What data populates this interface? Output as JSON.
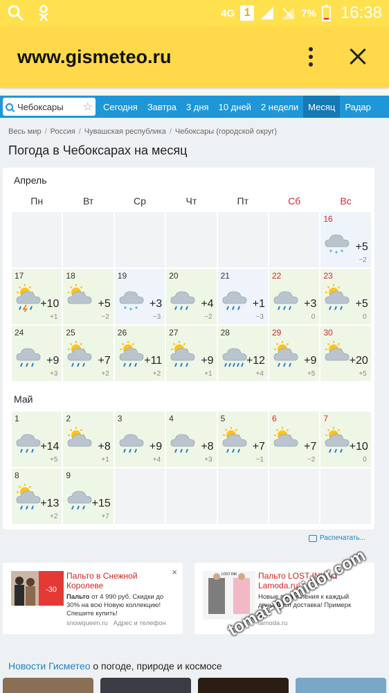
{
  "status_bar": {
    "network": "4G",
    "sim_badge": "1",
    "battery": "7%",
    "time": "16:38"
  },
  "url_bar": {
    "url": "www.gismeteo.ru"
  },
  "nav": {
    "city": "Чебоксары",
    "items": [
      {
        "label": "Сегодня"
      },
      {
        "label": "Завтра"
      },
      {
        "label": "3 дня"
      },
      {
        "label": "10 дней"
      },
      {
        "label": "2 недели"
      },
      {
        "label": "Месяц",
        "active": true
      },
      {
        "label": "Радар"
      }
    ]
  },
  "breadcrumbs": [
    "Весь мир",
    "Россия",
    "Чувашская республика",
    "Чебоксары (городской округ)"
  ],
  "page_title": "Погода в Чебоксарах на месяц",
  "weekdays": [
    "Пн",
    "Вт",
    "Ср",
    "Чт",
    "Пт",
    "Сб",
    "Вс"
  ],
  "months": [
    {
      "name": "Апрель",
      "cells": [
        null,
        null,
        null,
        null,
        null,
        null,
        {
          "day": "16",
          "hi": "+5",
          "lo": "−2",
          "icon": "cloud-snow-icon",
          "bg": "cool"
        },
        {
          "day": "17",
          "hi": "+10",
          "lo": "+1",
          "icon": "sun-cloud-storm-icon",
          "bg": "warm"
        },
        {
          "day": "18",
          "hi": "+5",
          "lo": "−2",
          "icon": "sun-cloud-icon",
          "bg": "warm"
        },
        {
          "day": "19",
          "hi": "+3",
          "lo": "−3",
          "icon": "cloud-snow-icon",
          "bg": "cool"
        },
        {
          "day": "20",
          "hi": "+4",
          "lo": "−2",
          "icon": "cloud-rain-icon",
          "bg": "warm"
        },
        {
          "day": "21",
          "hi": "+1",
          "lo": "−3",
          "icon": "cloud-rain-icon",
          "bg": "cool"
        },
        {
          "day": "22",
          "hi": "+3",
          "lo": "0",
          "icon": "cloud-rain-icon",
          "bg": "warm"
        },
        {
          "day": "23",
          "hi": "+5",
          "lo": "0",
          "icon": "sun-cloud-rain-icon",
          "bg": "warm"
        },
        {
          "day": "24",
          "hi": "+9",
          "lo": "+3",
          "icon": "cloud-rain-icon",
          "bg": "warm"
        },
        {
          "day": "25",
          "hi": "+7",
          "lo": "+2",
          "icon": "sun-cloud-rain-icon",
          "bg": "warm"
        },
        {
          "day": "26",
          "hi": "+11",
          "lo": "+2",
          "icon": "sun-cloud-rain-icon",
          "bg": "warm"
        },
        {
          "day": "27",
          "hi": "+9",
          "lo": "+1",
          "icon": "sun-cloud-rain-icon",
          "bg": "warm"
        },
        {
          "day": "28",
          "hi": "+12",
          "lo": "+4",
          "icon": "cloud-heavy-rain-icon",
          "bg": "warm"
        },
        {
          "day": "29",
          "hi": "+9",
          "lo": "+5",
          "icon": "sun-cloud-rain-icon",
          "bg": "warm"
        },
        {
          "day": "30",
          "hi": "+20",
          "lo": "+5",
          "icon": "sun-cloud-icon",
          "bg": "warm"
        }
      ]
    },
    {
      "name": "Май",
      "cells": [
        {
          "day": "1",
          "hi": "+14",
          "lo": "+5",
          "icon": "cloud-rain-icon",
          "bg": "warm"
        },
        {
          "day": "2",
          "hi": "+8",
          "lo": "+1",
          "icon": "sun-cloud-icon",
          "bg": "warm"
        },
        {
          "day": "3",
          "hi": "+9",
          "lo": "+4",
          "icon": "cloud-rain-icon",
          "bg": "warm"
        },
        {
          "day": "4",
          "hi": "+8",
          "lo": "+3",
          "icon": "cloud-rain-icon",
          "bg": "warm"
        },
        {
          "day": "5",
          "hi": "+7",
          "lo": "−1",
          "icon": "sun-cloud-rain-icon",
          "bg": "warm"
        },
        {
          "day": "6",
          "hi": "+7",
          "lo": "−2",
          "icon": "sun-cloud-icon",
          "bg": "warm"
        },
        {
          "day": "7",
          "hi": "+10",
          "lo": "0",
          "icon": "sun-cloud-rain-icon",
          "bg": "warm"
        },
        {
          "day": "8",
          "hi": "+13",
          "lo": "+2",
          "icon": "sun-cloud-rain-icon",
          "bg": "warm"
        },
        {
          "day": "9",
          "hi": "+15",
          "lo": "+7",
          "icon": "cloud-rain-icon",
          "bg": "warm"
        },
        null,
        null,
        null,
        null,
        null
      ]
    }
  ],
  "print_label": "Распечатать...",
  "ads": [
    {
      "title": "Пальто в Снежной Королеве",
      "text_bold": "Пальто",
      "text": " от 4 990 руб. Скидки до 30% на всю Новую коллекцию! Спешите купить!",
      "source": "snowqueen.ru",
      "source_extra": "Адрес и телефон",
      "badge": "-30",
      "close": "×"
    },
    {
      "title": "Пальто LOST INK на Lamoda.ru!",
      "text": "Новые поступления к каждый день! Бесп доставка! Примерк",
      "source": "lamoda.ru",
      "brand_tag": "LOST INK"
    }
  ],
  "news": {
    "link": "Новости Гисметео",
    "rest": " о погоде, природе и космосе"
  },
  "watermark": "tomat-pomidor.com",
  "colors": {
    "statusbar": "#ffe14f",
    "urlbar": "#ffd94a",
    "nav": "#1e96d8",
    "weekend": "#d9262c"
  }
}
